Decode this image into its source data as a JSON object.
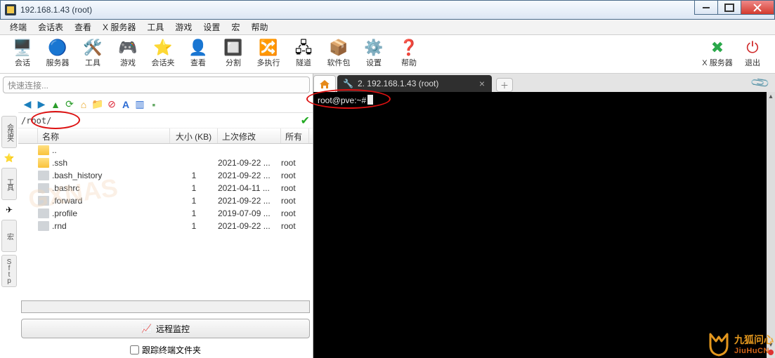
{
  "window": {
    "title": "192.168.1.43 (root)"
  },
  "menu": [
    "终端",
    "会话表",
    "查看",
    "X 服务器",
    "工具",
    "游戏",
    "设置",
    "宏",
    "帮助"
  ],
  "toolbar": [
    {
      "label": "会话",
      "icon": "🖥️"
    },
    {
      "label": "服务器",
      "icon": "🔵"
    },
    {
      "label": "工具",
      "icon": "🛠️"
    },
    {
      "label": "游戏",
      "icon": "🎮"
    },
    {
      "label": "会话夹",
      "icon": "⭐"
    },
    {
      "label": "查看",
      "icon": "👤"
    },
    {
      "label": "分割",
      "icon": "🔲"
    },
    {
      "label": "多执行",
      "icon": "🔀"
    },
    {
      "label": "隧道",
      "icon": "🖧"
    },
    {
      "label": "软件包",
      "icon": "📦"
    },
    {
      "label": "设置",
      "icon": "⚙️"
    },
    {
      "label": "帮助",
      "icon": "❓"
    }
  ],
  "toolbar_right": [
    {
      "label": "X 服务器",
      "icon": "✖",
      "color": "#2aa84a"
    },
    {
      "label": "退出",
      "icon": "⏻",
      "color": "#d02a2a"
    }
  ],
  "quickconnect_placeholder": "快速连接...",
  "sidetabs": {
    "labels": [
      "会话夹",
      "工具",
      "宏",
      "Sftp"
    ],
    "icons": [
      "⭐",
      "✈"
    ]
  },
  "sftp": {
    "path": "/root/",
    "columns": {
      "name": "名称",
      "size": "大小 (KB)",
      "date": "上次修改",
      "owner": "所有"
    },
    "rows": [
      {
        "name": "..",
        "type": "up",
        "size": "",
        "date": "",
        "owner": ""
      },
      {
        "name": ".ssh",
        "type": "folder",
        "size": "",
        "date": "2021-09-22 ...",
        "owner": "root"
      },
      {
        "name": ".bash_history",
        "type": "file",
        "size": "1",
        "date": "2021-09-22 ...",
        "owner": "root"
      },
      {
        "name": ".bashrc",
        "type": "file",
        "size": "1",
        "date": "2021-04-11 ...",
        "owner": "root"
      },
      {
        "name": ".forward",
        "type": "file",
        "size": "1",
        "date": "2021-09-22 ...",
        "owner": "root"
      },
      {
        "name": ".profile",
        "type": "file",
        "size": "1",
        "date": "2019-07-09 ...",
        "owner": "root"
      },
      {
        "name": ".rnd",
        "type": "file",
        "size": "1",
        "date": "2021-09-22 ...",
        "owner": "root"
      }
    ],
    "monitor_label": "远程监控",
    "track_label": "跟踪终端文件夹"
  },
  "tabs": {
    "ssh_label": "2. 192.168.1.43 (root)"
  },
  "terminal": {
    "prompt": "root@pve:~#"
  },
  "watermark": {
    "cn": "九狐问心",
    "en": "JiuHuCN"
  }
}
